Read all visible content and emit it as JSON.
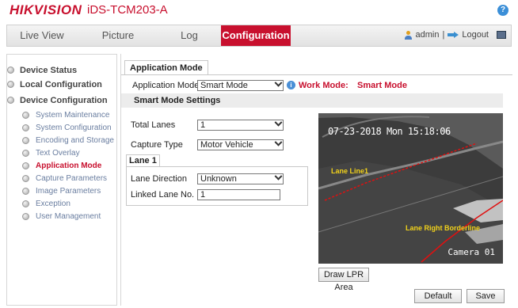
{
  "header": {
    "brand": "HIKVISION",
    "model": "iDS-TCM203-A",
    "help_icon": "?"
  },
  "nav": {
    "tabs": [
      {
        "label": "Live View"
      },
      {
        "label": "Picture"
      },
      {
        "label": "Log"
      },
      {
        "label": "Configuration"
      }
    ],
    "user": "admin",
    "separator": "|",
    "logout": "Logout"
  },
  "sidebar": {
    "items": [
      {
        "label": "Device Status"
      },
      {
        "label": "Local Configuration"
      },
      {
        "label": "Device Configuration"
      }
    ],
    "subitems": [
      {
        "label": "System Maintenance"
      },
      {
        "label": "System Configuration"
      },
      {
        "label": "Encoding and Storage"
      },
      {
        "label": "Text Overlay"
      },
      {
        "label": "Application Mode"
      },
      {
        "label": "Capture Parameters"
      },
      {
        "label": "Image Parameters"
      },
      {
        "label": "Exception"
      },
      {
        "label": "User Management"
      }
    ]
  },
  "main": {
    "tab": "Application Mode",
    "app_mode_label": "Application Mode",
    "app_mode_value": "Smart Mode",
    "work_mode_label": "Work Mode:",
    "work_mode_value": "Smart Mode",
    "smart_settings_header": "Smart Mode Settings",
    "total_lanes_label": "Total Lanes",
    "total_lanes_value": "1",
    "capture_type_label": "Capture Type",
    "capture_type_value": "Motor Vehicle",
    "lane_tab": "Lane 1",
    "lane_direction_label": "Lane Direction",
    "lane_direction_value": "Unknown",
    "linked_lane_label": "Linked Lane No.",
    "linked_lane_value": "1"
  },
  "video": {
    "timestamp": "07-23-2018 Mon 15:18:06",
    "lane_line_label": "Lane Line1",
    "right_border_label": "Lane Right Borderline",
    "camera_label": "Camera 01"
  },
  "buttons": {
    "draw_lpr": "Draw LPR Area",
    "default": "Default",
    "save": "Save"
  },
  "colors": {
    "accent": "#c8102e",
    "overlay_text": "#f2d21a",
    "lane_line": "#e01010"
  }
}
